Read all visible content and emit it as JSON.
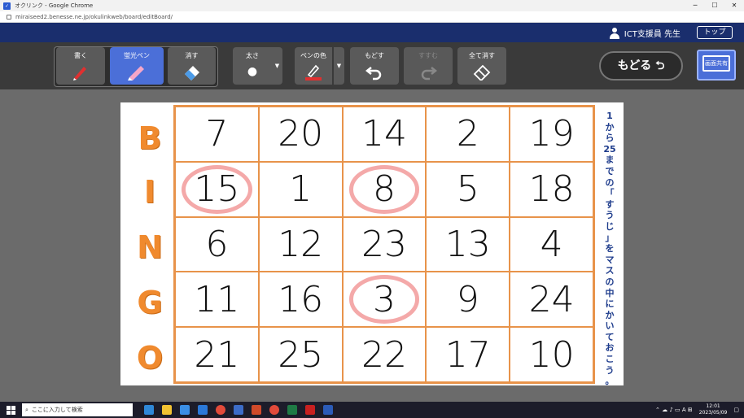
{
  "window": {
    "title": "オクリンク - Google Chrome",
    "url": "miraiseed2.benesse.ne.jp/okulinkweb/board/editBoard/"
  },
  "header": {
    "user": "ICT支援員 先生",
    "top_button": "トップ"
  },
  "toolbar": {
    "write": "書く",
    "highlighter": "蛍光ペン",
    "erase": "消す",
    "thickness": "太さ",
    "pen_color": "ペンの色",
    "undo": "もどす",
    "redo": "すすむ",
    "clear_all": "全て消す",
    "back": "もどる",
    "screen_share": "画面共有",
    "pen_color_value": "#e03030"
  },
  "bingo": {
    "letters": [
      "B",
      "I",
      "N",
      "G",
      "O"
    ],
    "rows": [
      [
        "7",
        "20",
        "14",
        "2",
        "19"
      ],
      [
        "15",
        "1",
        "8",
        "5",
        "18"
      ],
      [
        "6",
        "12",
        "23",
        "13",
        "4"
      ],
      [
        "11",
        "16",
        "3",
        "9",
        "24"
      ],
      [
        "21",
        "25",
        "22",
        "17",
        "10"
      ]
    ],
    "circled": [
      "15",
      "8",
      "3"
    ],
    "instruction": "1から25までの「すうじ」をマスの中にかいておこう。"
  },
  "taskbar": {
    "search_placeholder": "ここに入力して検索",
    "time": "12:01",
    "date": "2023/05/09"
  }
}
